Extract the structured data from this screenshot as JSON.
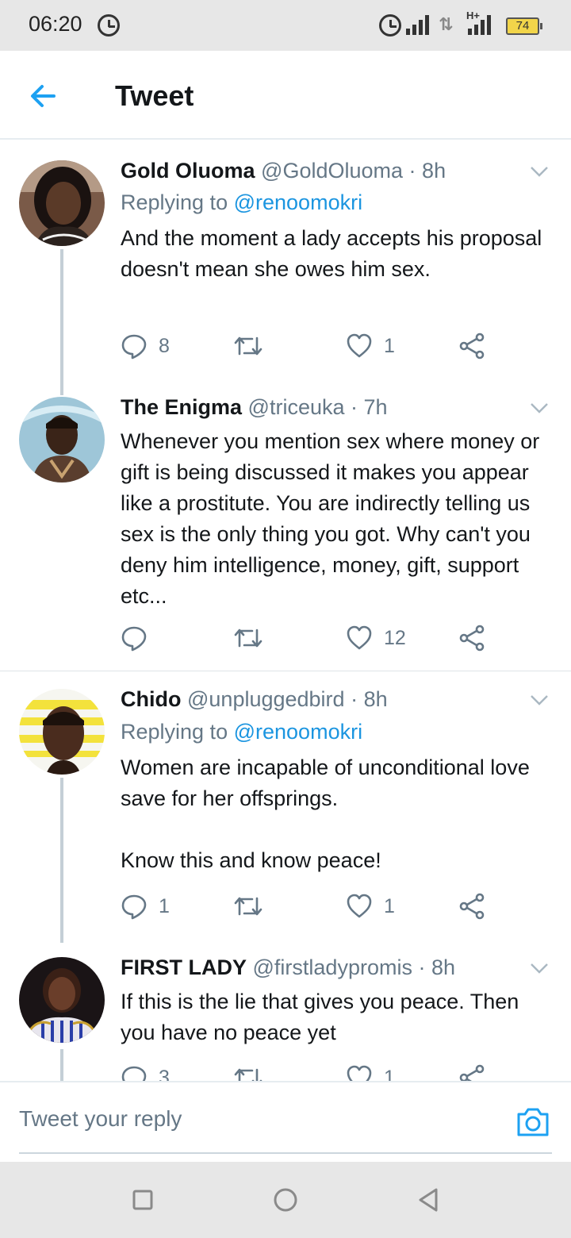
{
  "status_bar": {
    "time": "06:20",
    "battery": "74",
    "network_label": "H+",
    "icons": [
      "alarm-icon",
      "signal-icon",
      "data-arrows-icon",
      "battery-icon"
    ]
  },
  "header": {
    "title": "Tweet",
    "back_icon": "back-arrow-icon"
  },
  "colors": {
    "accent": "#1b95e0",
    "muted_text": "#657786",
    "text": "#14171a",
    "thread_line": "#c4cfd6",
    "battery": "#f2d54a"
  },
  "tweets": [
    {
      "name": "Gold Oluoma",
      "handle": "@GoldOluoma",
      "separator": "·",
      "time": "8h",
      "replying_prefix": "Replying to",
      "replying_to": "@renoomokri",
      "body": "And the moment a lady accepts his proposal doesn't mean she owes him sex.",
      "replies": "8",
      "retweets": "",
      "likes": "1"
    },
    {
      "name": "The Enigma",
      "handle": "@triceuka",
      "separator": "·",
      "time": "7h",
      "body": "Whenever you mention sex where money or gift is being discussed it makes you appear like a prostitute. You are indirectly telling us sex is the only thing you got. Why can't you deny him intelligence, money, gift, support etc...",
      "replies": "",
      "retweets": "",
      "likes": "12"
    },
    {
      "name": "Chido",
      "handle": "@unpluggedbird",
      "separator": "·",
      "time": "8h",
      "replying_prefix": "Replying to",
      "replying_to": "@renoomokri",
      "body": "Women are incapable of unconditional love save for her offsprings.\n\nKnow this and know peace!",
      "replies": "1",
      "retweets": "",
      "likes": "1"
    },
    {
      "name": "FIRST LADY",
      "handle": "@firstladypromis",
      "separator": "·",
      "time": "8h",
      "body": "If this is the lie that gives you peace. Then you have no peace yet",
      "replies": "3",
      "retweets": "",
      "likes": "1"
    }
  ],
  "reply_bar": {
    "placeholder": "Tweet your reply",
    "camera_icon": "camera-icon"
  },
  "nav_bar": {
    "buttons": [
      "recents-square-icon",
      "home-circle-icon",
      "back-triangle-icon"
    ]
  }
}
